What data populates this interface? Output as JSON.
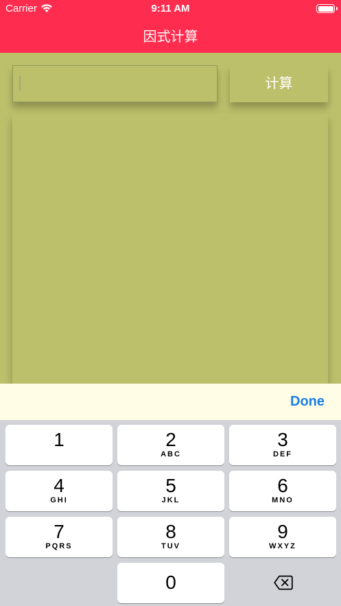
{
  "status_bar": {
    "carrier": "Carrier",
    "time": "9:11 AM"
  },
  "nav": {
    "title": "因式计算"
  },
  "input": {
    "value": "",
    "placeholder": ""
  },
  "calculate_button": {
    "label": "计算"
  },
  "toolbar": {
    "done_label": "Done"
  },
  "keypad": {
    "keys": [
      {
        "digit": "1",
        "letters": ""
      },
      {
        "digit": "2",
        "letters": "ABC"
      },
      {
        "digit": "3",
        "letters": "DEF"
      },
      {
        "digit": "4",
        "letters": "GHI"
      },
      {
        "digit": "5",
        "letters": "JKL"
      },
      {
        "digit": "6",
        "letters": "MNO"
      },
      {
        "digit": "7",
        "letters": "PQRS"
      },
      {
        "digit": "8",
        "letters": "TUV"
      },
      {
        "digit": "9",
        "letters": "WXYZ"
      },
      {
        "digit": "0",
        "letters": ""
      }
    ],
    "delete_icon": "backspace-icon"
  },
  "colors": {
    "accent": "#fe2d4f",
    "background": "#bdc06b",
    "toolbar": "#fffde6",
    "done": "#1a7fe6",
    "keypad": "#d1d3d9"
  }
}
